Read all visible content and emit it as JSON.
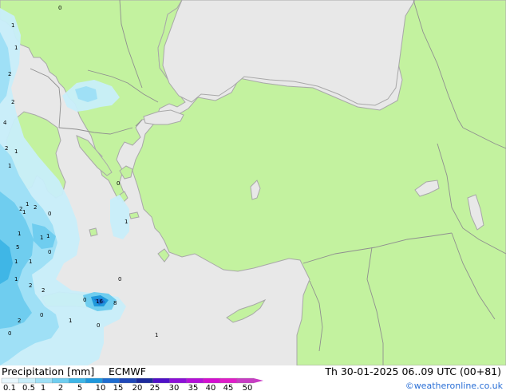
{
  "title": {
    "variable": "Precipitation [mm]",
    "model": "ECMWF",
    "valid_time": "Th 30-01-2025 06..09 UTC (00+81)",
    "credit": "©weatheronline.co.uk"
  },
  "colors": {
    "sea": "#e8e8e8",
    "land": "#c3f29f",
    "coast": "#a8a8a8",
    "border": "#8f8f8f"
  },
  "legend": {
    "ticks": [
      "0.1",
      "0.5",
      "1",
      "2",
      "5",
      "10",
      "15",
      "20",
      "25",
      "30",
      "35",
      "40",
      "45",
      "50"
    ],
    "colors": [
      "#e8f7fd",
      "#c8eefa",
      "#9fe0f6",
      "#6fcdef",
      "#3fb6e6",
      "#1f98dc",
      "#1e6cd0",
      "#2048b8",
      "#1c2a9c",
      "#5010c8",
      "#8c10d8",
      "#b410d8",
      "#d40fd0",
      "#e01ec8",
      "#c83cc4"
    ]
  },
  "station_values": [
    {
      "text": "0",
      "fill": "#ffffff"
    },
    {
      "text": "1",
      "fill": "#ffffff"
    },
    {
      "text": "1",
      "fill": "#ffffff"
    },
    {
      "text": "2",
      "fill": "#ffffff"
    },
    {
      "text": "2",
      "fill": "#ffffff"
    },
    {
      "text": "2",
      "fill": "#ffffff"
    },
    {
      "text": "1",
      "fill": "#ffffff"
    },
    {
      "text": "4",
      "fill": "#ffffff"
    },
    {
      "text": "2",
      "fill": "#ffffff"
    },
    {
      "text": "1",
      "fill": "#ffffff"
    },
    {
      "text": "2",
      "fill": "#ffffff"
    },
    {
      "text": "1",
      "fill": "#ffffff"
    },
    {
      "text": "1",
      "fill": "#ffffff"
    },
    {
      "text": "5",
      "fill": "#ffffff"
    },
    {
      "text": "1",
      "fill": "#ffffff"
    },
    {
      "text": "1",
      "fill": "#ffffff"
    },
    {
      "text": "0",
      "fill": "#ffffff"
    },
    {
      "text": "1",
      "fill": "#ffffff"
    },
    {
      "text": "16",
      "fill": "#ffffff"
    },
    {
      "text": "8",
      "fill": "#ffffff"
    },
    {
      "text": "2",
      "fill": "#ffffff"
    },
    {
      "text": "0",
      "fill": "#ffffff"
    },
    {
      "text": "1",
      "fill": "#ffffff"
    },
    {
      "text": "0",
      "fill": "#ffffff"
    },
    {
      "text": "1",
      "fill": "#ffffff"
    },
    {
      "text": "0",
      "fill": "#ffffff"
    },
    {
      "text": "1",
      "fill": "#ffffff"
    },
    {
      "text": "0",
      "fill": "#ffffff"
    },
    {
      "text": "2",
      "fill": "#ffffff"
    },
    {
      "text": "0",
      "fill": "#ffffff"
    },
    {
      "text": "1",
      "fill": "#ffffff"
    },
    {
      "text": "0",
      "fill": "#ffffff"
    },
    {
      "text": "2",
      "fill": "#ffffff"
    },
    {
      "text": "1",
      "fill": "#ffffff"
    },
    {
      "text": "1",
      "fill": "#ffffff"
    },
    {
      "text": "0",
      "fill": "#ffffff"
    }
  ]
}
